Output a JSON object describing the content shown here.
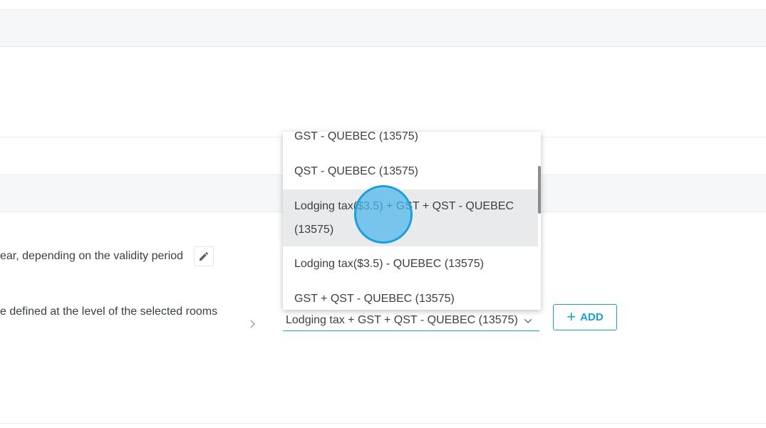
{
  "rows": {
    "validity_text": "ear, depending on the validity period",
    "rooms_text": "e defined at the level of the selected rooms"
  },
  "tax_select": {
    "value": "Lodging tax + GST + QST - QUEBEC (13575)"
  },
  "dropdown": {
    "options": [
      "GST - QUEBEC (13575)",
      "QST - QUEBEC (13575)",
      "Lodging tax($3.5) + GST + QST - QUEBEC",
      "(13575)",
      "Lodging tax($3.5) - QUEBEC (13575)",
      "GST + QST - QUEBEC (13575)"
    ],
    "highlighted_index": 2
  },
  "add_button": {
    "plus": "+",
    "label": "ADD"
  },
  "icons": {
    "edit": "pencil-icon",
    "row_chevron": "chevron-right-icon",
    "select_chevron": "chevron-down-icon"
  },
  "colors": {
    "accent": "#1aa3c7",
    "highlight": "#e8eaec",
    "cursor": "#4bb7eb"
  }
}
